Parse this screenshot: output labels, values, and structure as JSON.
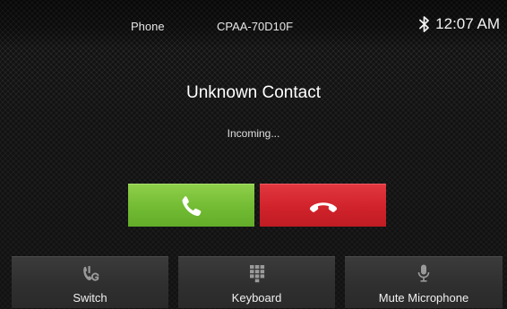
{
  "status_bar": {
    "source": "Phone",
    "device": "CPAA-70D10F",
    "bluetooth_icon": "bluetooth-icon",
    "time": "12:07 AM"
  },
  "call": {
    "contact_name": "Unknown Contact",
    "status": "Incoming...",
    "answer_icon": "phone-answer-icon",
    "decline_icon": "phone-hangup-icon",
    "answer_color": "#72bb33",
    "decline_color": "#d0222b"
  },
  "functions": [
    {
      "label": "Switch",
      "icon": "switch-audio-icon"
    },
    {
      "label": "Keyboard",
      "icon": "keypad-icon"
    },
    {
      "label": "Mute Microphone",
      "icon": "microphone-icon"
    }
  ]
}
